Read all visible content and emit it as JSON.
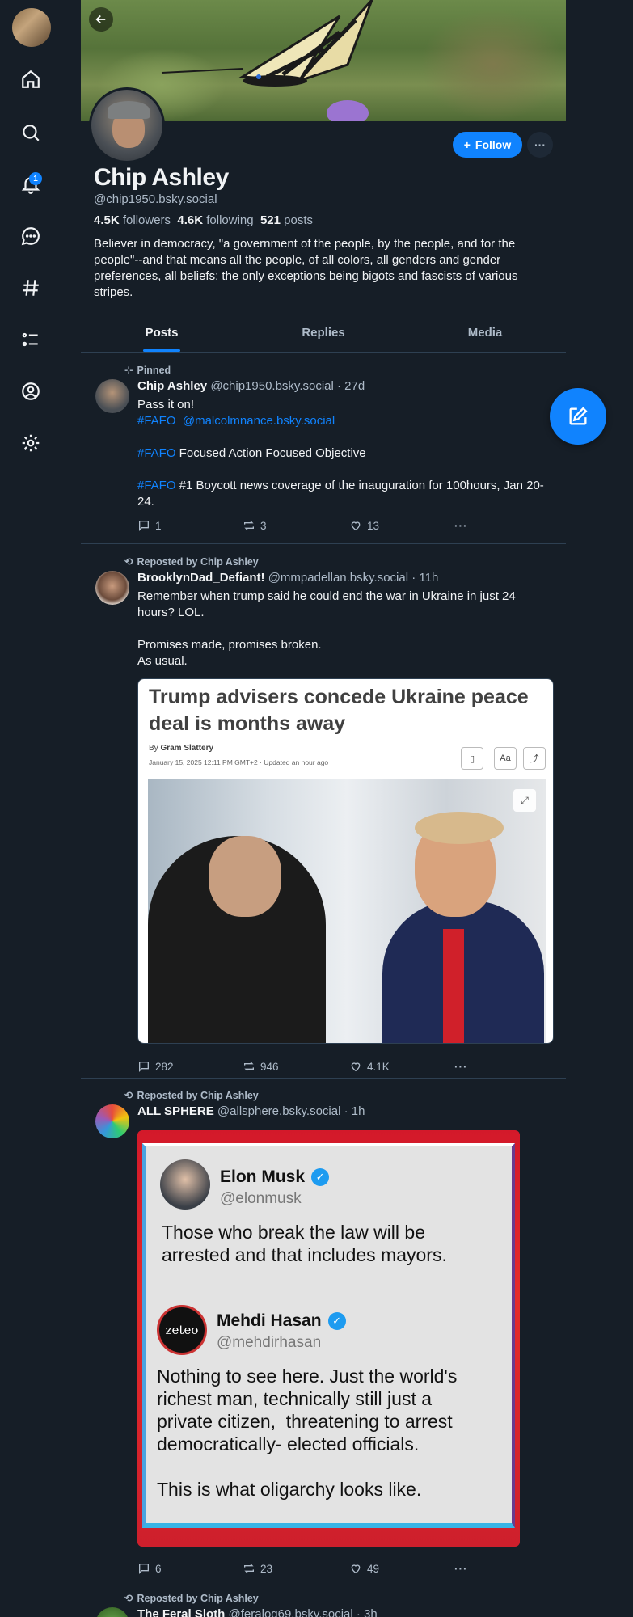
{
  "nav": {
    "items": [
      "home-icon",
      "search-icon",
      "bell-icon",
      "chat-icon",
      "hashtag-icon",
      "list-icon",
      "person-icon",
      "gear-icon"
    ],
    "notification_count": "1"
  },
  "profile": {
    "name": "Chip Ashley",
    "handle": "@chip1950.bsky.social",
    "followers_count": "4.5K",
    "followers_label": "followers",
    "following_count": "4.6K",
    "following_label": "following",
    "posts_count": "521",
    "posts_label": "posts",
    "bio": "Believer in democracy, \"a government of the people, by the people, and for the people\"--and that means all the people, of all colors, all genders and gender preferences, all beliefs; the only exceptions being bigots and fascists of various stripes.",
    "follow_label": "Follow",
    "more_label": "···"
  },
  "tabs": [
    "Posts",
    "Replies",
    "Media"
  ],
  "posts": [
    {
      "meta": "Pinned",
      "author": "Chip Ashley",
      "handle": "@chip1950.bsky.social",
      "time": "· 27d",
      "line1": "Pass it on!",
      "tag1": "#FAFO",
      "mention": "@malcolmnance.bsky.social",
      "tag2": "#FAFO",
      "line2": " Focused Action Focused Objective",
      "tag3": "#FAFO",
      "line3": " #1 Boycott news coverage of the inauguration for 100hours, Jan 20-24.",
      "replies": "1",
      "reposts": "3",
      "likes": "13"
    },
    {
      "meta": "Reposted by Chip Ashley",
      "author": "BrooklynDad_Defiant!",
      "handle": "@mmpadellan.bsky.social",
      "time": "· 11h",
      "text": "Remember when trump said he could end the war in Ukraine in just 24 hours? LOL.\n\nPromises made, promises broken.\nAs usual.",
      "article_title": "Trump advisers concede Ukraine peace deal is months away",
      "article_by_prefix": "By ",
      "article_by": "Gram Slattery",
      "article_date": "January 15, 2025 12:11 PM GMT+2 · Updated an hour ago",
      "article_btn_aa": "Aa",
      "replies": "282",
      "reposts": "946",
      "likes": "4.1K"
    },
    {
      "meta": "Reposted by Chip Ashley",
      "author": "ALL SPHERE",
      "handle": "@allsphere.bsky.social",
      "time": "· 1h",
      "tw1_name": "Elon Musk",
      "tw1_handle": "@elonmusk",
      "tw1_text": "Those who break the law will be\narrested and that includes mayors.",
      "tw2_name": "Mehdi Hasan",
      "tw2_handle": "@mehdirhasan",
      "tw2_avatar_text": "zeteo",
      "tw2_text": "Nothing to see here. Just the world's\nrichest man, technically still just a\nprivate citizen,  threatening to arrest\ndemocratically- elected officials.\n\nThis is what oligarchy looks like.",
      "replies": "6",
      "reposts": "23",
      "likes": "49"
    },
    {
      "meta": "Reposted by Chip Ashley",
      "author": "The Feral Sloth",
      "handle": "@feralog69.bsky.social",
      "time": "· 3h"
    }
  ],
  "colors": {
    "accent": "#1083fe",
    "background": "#161e27",
    "border": "#2e4052",
    "muted": "#aebbc9"
  }
}
